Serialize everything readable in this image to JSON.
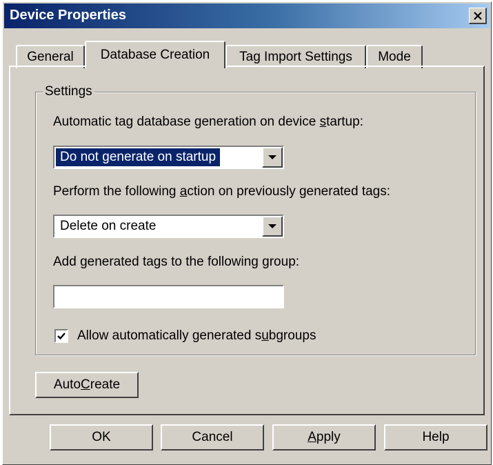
{
  "window": {
    "title": "Device Properties",
    "close_icon": "close-x-icon"
  },
  "tabs": [
    {
      "label": "General",
      "active": false
    },
    {
      "label": "Database Creation",
      "active": true
    },
    {
      "label": "Tag Import Settings",
      "active": false
    },
    {
      "label": "Mode",
      "active": false
    }
  ],
  "settings": {
    "group_title": "Settings",
    "startup_label": {
      "pre": "Automatic tag database generation on device ",
      "mnemonic": "s",
      "post": "tartup:"
    },
    "startup_value": "Do not generate on startup",
    "action_label": {
      "pre": "Perform the following ",
      "mnemonic": "a",
      "post": "ction on previously generated tags:"
    },
    "action_value": "Delete on create",
    "group_label": {
      "pre": "Add generated tags to the following ",
      "mnemonic": "g",
      "post": "roup:"
    },
    "group_value": "",
    "subgroups_label": {
      "pre": "Allow automatically generated s",
      "mnemonic": "u",
      "post": "bgroups"
    },
    "subgroups_checked": true
  },
  "auto_create": {
    "pre": "Auto ",
    "mnemonic": "C",
    "post": "reate"
  },
  "buttons": {
    "ok": "OK",
    "cancel": "Cancel",
    "apply": {
      "pre": "",
      "mnemonic": "A",
      "post": "pply"
    },
    "help": "Help"
  }
}
